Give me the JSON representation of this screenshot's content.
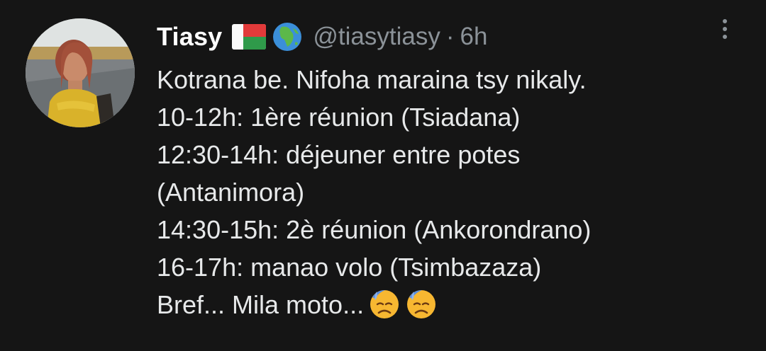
{
  "tweet": {
    "display_name": "Tiasy",
    "name_emojis": [
      "madagascar-flag",
      "globe-africa"
    ],
    "handle": "@tiasytiasy",
    "separator": "·",
    "time": "6h",
    "lines": [
      "Kotrana be. Nifoha maraina tsy nikaly.",
      "10-12h: 1ère réunion (Tsiadana)",
      "12:30-14h: déjeuner entre potes",
      "(Antanimora)",
      "14:30-15h: 2è réunion (Ankorondrano)",
      "16-17h: manao volo (Tsimbazaza)",
      "Bref... Mila moto..."
    ],
    "trailing_emojis": [
      "downcast-face-with-sweat",
      "downcast-face-with-sweat"
    ]
  },
  "colors": {
    "background": "#151515",
    "text": "#e7e9ea",
    "secondary_text": "#8b9298"
  }
}
